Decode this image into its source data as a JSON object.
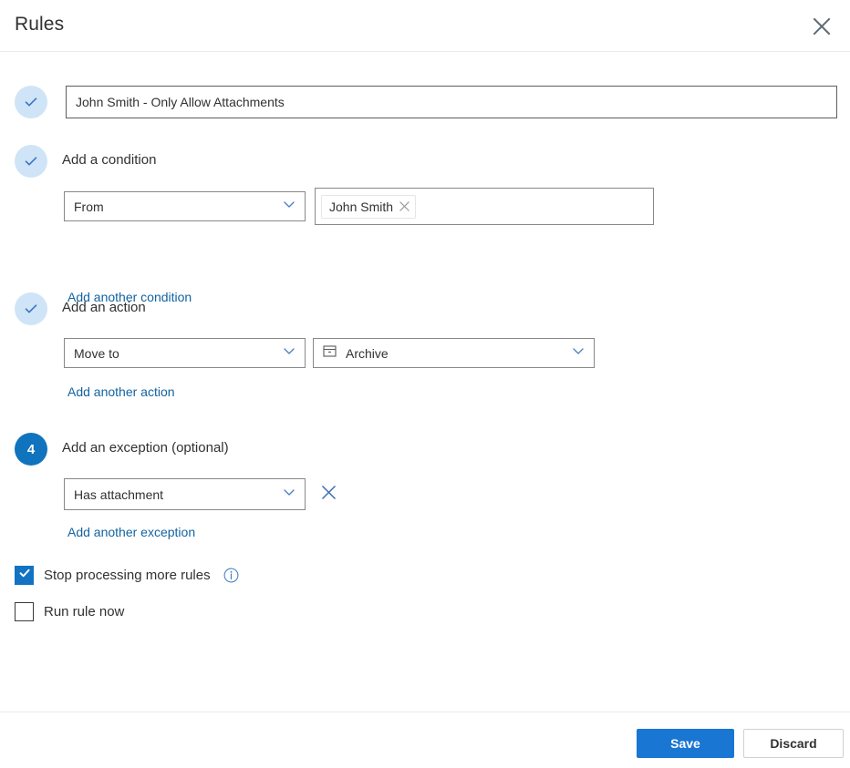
{
  "header": {
    "title": "Rules",
    "close_icon": "close-icon"
  },
  "steps": [
    {
      "id": "name",
      "badge": "✓",
      "badge_state": "done",
      "title": "",
      "input_value": "John Smith - Only Allow Attachments",
      "input_placeholder": "Name your rule"
    },
    {
      "id": "condition",
      "badge": "✓",
      "badge_state": "done",
      "title": "Add a condition",
      "dropdown_value": "From",
      "chip_label": "John Smith",
      "chip_remove_icon": "close-icon",
      "add_link": "Add another condition"
    },
    {
      "id": "action",
      "badge": "✓",
      "badge_state": "done",
      "title": "Add an action",
      "dropdown_value": "Move to",
      "folder_icon": "archive-folder-icon",
      "folder_value": "Archive",
      "add_link": "Add another action"
    },
    {
      "id": "exception",
      "badge": "4",
      "badge_state": "active",
      "title": "Add an exception (optional)",
      "dropdown_value": "Has attachment",
      "delete_icon": "close-icon",
      "add_link": "Add another exception"
    }
  ],
  "options": {
    "stop_processing": {
      "label": "Stop processing more rules",
      "checked": true,
      "info_icon": "info-icon"
    },
    "run_now": {
      "label": "Run rule now",
      "checked": false
    }
  },
  "footer": {
    "save_label": "Save",
    "discard_label": "Discard"
  },
  "colors": {
    "accent": "#1073bd",
    "primary_button": "#1976d2",
    "link": "#1263a0",
    "badge_done_bg": "#cfe4f7",
    "checkbox_checked": "#1173c2"
  }
}
